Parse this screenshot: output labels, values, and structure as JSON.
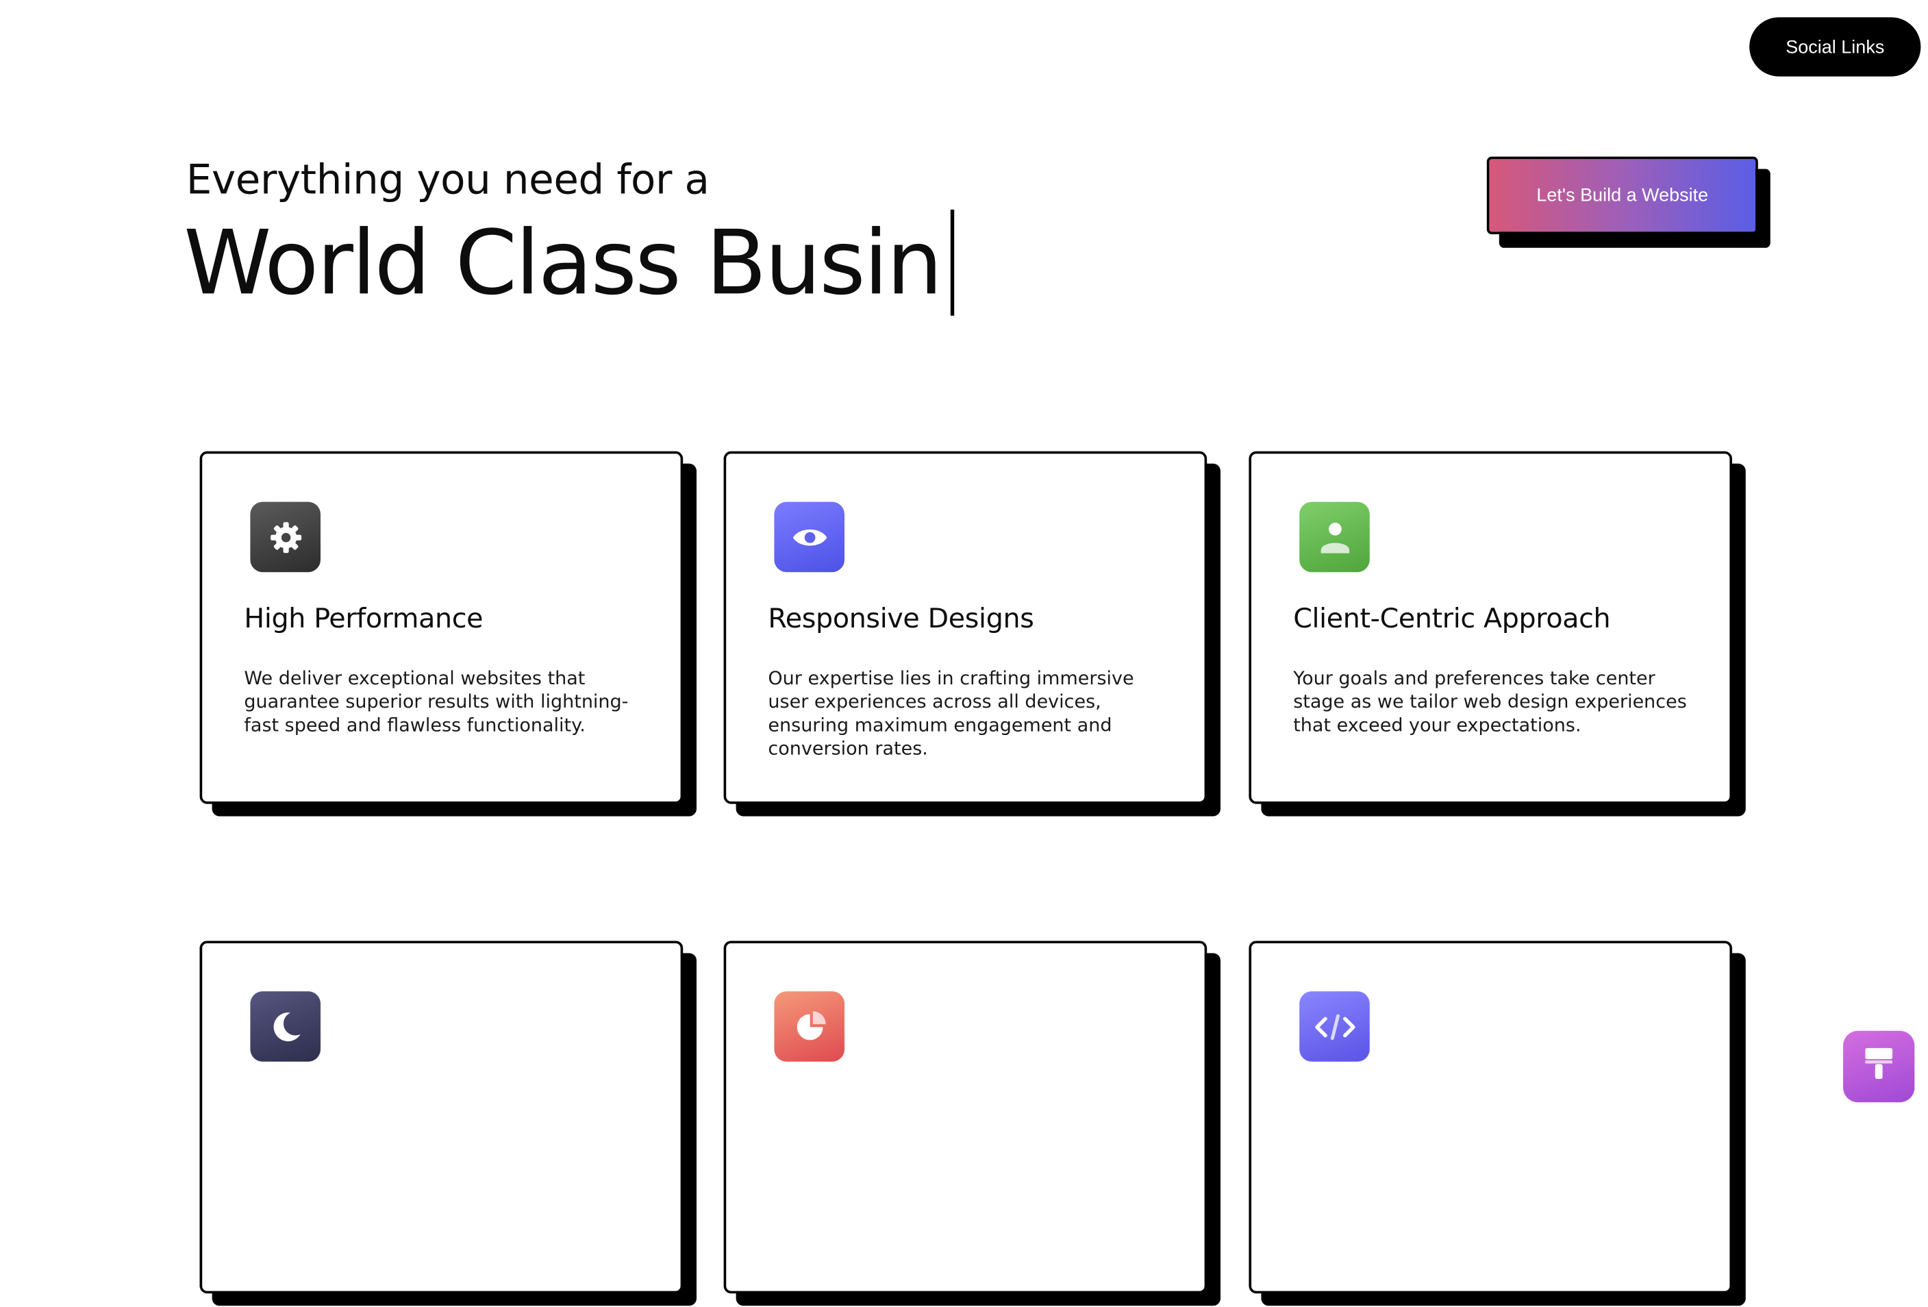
{
  "header": {
    "social_links_label": "Social Links"
  },
  "hero": {
    "line1": "Everything you need for a",
    "line2": "World Class Busin",
    "cta_label": "Let's Build a Website"
  },
  "cards": [
    {
      "icon": "gear-icon",
      "title": "High Performance",
      "description": "We deliver exceptional websites that guarantee superior results with lightning-fast speed and flawless functionality."
    },
    {
      "icon": "eye-icon",
      "title": "Responsive Designs",
      "description": "Our expertise lies in crafting immersive user experiences across all devices, ensuring maximum engagement and conversion rates."
    },
    {
      "icon": "user-icon",
      "title": "Client-Centric Approach",
      "description": "Your goals and preferences take center stage as we tailor web design experiences that exceed your expectations."
    },
    {
      "icon": "moon-icon"
    },
    {
      "icon": "pie-chart-icon"
    },
    {
      "icon": "code-icon"
    }
  ],
  "floating_button": {
    "icon": "paint-brush-icon"
  },
  "colors": {
    "cta_gradient_start": "#d6587a",
    "cta_gradient_end": "#5a5ee6",
    "text": "#0d0d0d",
    "background": "#ffffff"
  }
}
